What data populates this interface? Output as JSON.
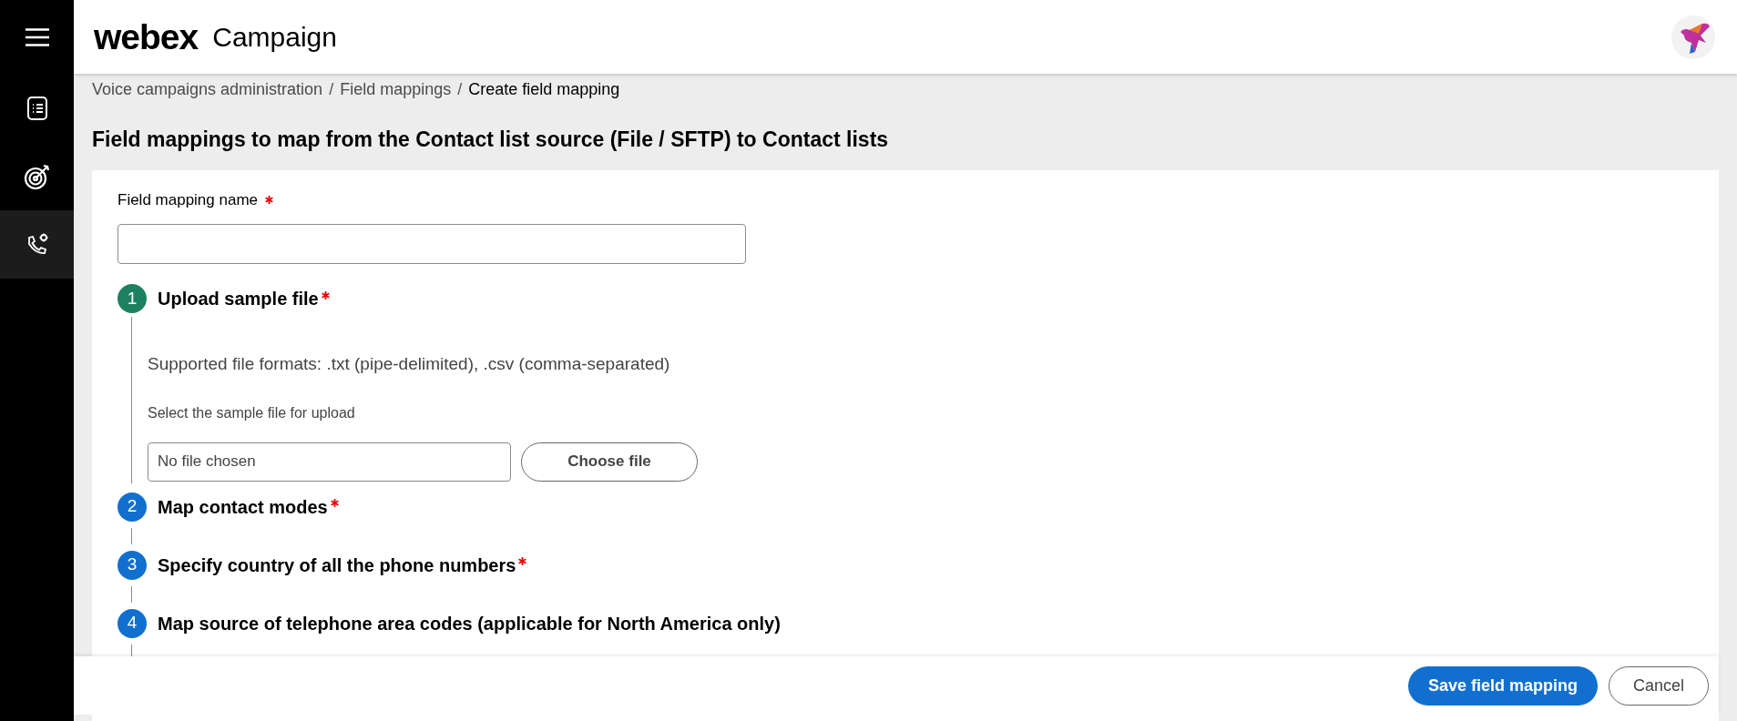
{
  "header": {
    "logo": "webex",
    "product": "Campaign"
  },
  "sidebar": {
    "items": [
      {
        "kind": "document",
        "selected": false
      },
      {
        "kind": "target",
        "selected": false
      },
      {
        "kind": "phone",
        "selected": true
      }
    ]
  },
  "breadcrumb": [
    {
      "label": "Voice campaigns administration",
      "current": false
    },
    {
      "separator": "/"
    },
    {
      "label": "Field mappings",
      "current": false
    },
    {
      "separator": "/"
    },
    {
      "label": "Create field mapping",
      "current": true
    }
  ],
  "page_title": "Field mappings to map from the Contact list source (File / SFTP) to Contact lists",
  "name_field": {
    "label": "Field mapping name",
    "required": true
  },
  "steps": [
    {
      "number": "1",
      "title": "Upload sample file",
      "required": true,
      "selected": true,
      "expanded": true,
      "formats": "Supported file formats: .txt (pipe-delimited), .csv (comma-separated)",
      "file_label": "Select the sample file for upload",
      "file_value": "No file chosen",
      "choose_button": "Choose file"
    },
    {
      "number": "2",
      "title": "Map contact modes",
      "required": true,
      "selected": false,
      "expanded": false
    },
    {
      "number": "3",
      "title": "Specify country of all the phone numbers",
      "required": true,
      "selected": false,
      "expanded": false
    },
    {
      "number": "4",
      "title": "Map source of telephone area codes (applicable for North America only)",
      "required": false,
      "selected": false,
      "expanded": false
    }
  ],
  "footer": {
    "buttons": [
      {
        "label": "Save field mapping",
        "kind": "primary"
      },
      {
        "label": "Cancel",
        "kind": "secondary"
      }
    ]
  }
}
